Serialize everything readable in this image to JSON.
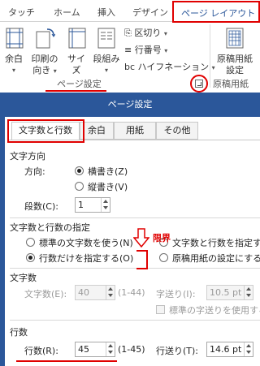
{
  "ribbon": {
    "tabs": [
      "タッチ",
      "ホーム",
      "挿入",
      "デザイン"
    ],
    "active_tab": "ページ レイアウト",
    "buttons": {
      "margins": "余白",
      "orientation_1": "印刷の",
      "orientation_2": "向き",
      "size": "サイズ",
      "columns": "段組み",
      "manuscript_1": "原稿用紙",
      "manuscript_2": "設定",
      "manuscript_group": "原稿用紙"
    },
    "small_buttons": {
      "breaks": "区切り",
      "line_numbers": "行番号",
      "hyphenation": "ハイフネーション"
    },
    "group_label": "ページ設定"
  },
  "dialog": {
    "title": "ページ設定",
    "tabs": [
      "文字数と行数",
      "余白",
      "用紙",
      "その他"
    ],
    "direction": {
      "section": "文字方向",
      "label": "方向:",
      "horizontal": "横書き(Z)",
      "vertical": "縦書き(V)",
      "columns_label": "段数(C):",
      "columns_value": "1"
    },
    "grid": {
      "section": "文字数と行数の指定",
      "opt_standard": "標準の文字数を使う(N)",
      "opt_lines_only": "行数だけを指定する(O)",
      "opt_chars_lines": "文字数と行数を指定する",
      "opt_manuscript": "原稿用紙の設定にする("
    },
    "chars": {
      "section": "文字数",
      "label": "文字数(E):",
      "value": "40",
      "range": "(1-44)",
      "pitch_label": "字送り(I):",
      "pitch_value": "10.5 pt",
      "use_standard": "標準の字送りを使用する"
    },
    "lines": {
      "section": "行数",
      "label": "行数(R):",
      "value": "45",
      "range": "(1-45)",
      "pitch_label": "行送り(T):",
      "pitch_value": "14.6 pt",
      "limit_label": "限界"
    }
  },
  "colors": {
    "accent": "#2b579a",
    "annotation": "#e00000"
  }
}
